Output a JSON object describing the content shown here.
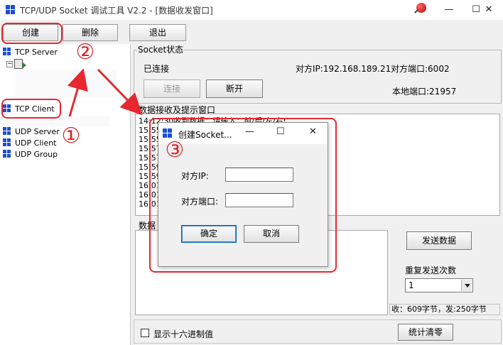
{
  "window": {
    "title": "TCP/UDP Socket 调试工具 V2.2 - [数据收发窗口]",
    "minimize_glyph": "—",
    "maximize_glyph": "☐",
    "close_glyph": "✕"
  },
  "toolbar": {
    "create_label": "创建",
    "delete_label": "删除",
    "exit_label": "退出"
  },
  "tree": {
    "tcp_server": "TCP Server",
    "tcp_client": "TCP Client",
    "udp_server": "UDP Server",
    "udp_client": "UDP Client",
    "udp_group": "UDP Group"
  },
  "socket_status": {
    "group_title": "Socket状态",
    "state": "已连接",
    "peer_ip": "对方IP:192.168.189.21",
    "peer_port": "对方端口:6002",
    "local_port": "本地端口:21957",
    "connect_label": "连接",
    "disconnect_label": "断开"
  },
  "receive": {
    "group_title": "数据接收及提示窗口",
    "lines": [
      "14:12:30收到数据：请输入：前/后/左/右!",
      "15:55",
      "15:55",
      "15:57",
      "15:57",
      "15:59",
      "15:59",
      "16:01",
      "16:01",
      "16:01"
    ]
  },
  "send": {
    "group_title": "数据",
    "send_label": "发送数据",
    "repeat_label": "重复发送次数",
    "repeat_value": "1",
    "status": "收：609字节，发:250字节"
  },
  "bottom": {
    "hex_label": "显示十六进制值",
    "clear_label": "统计清零"
  },
  "dialog": {
    "title": "创建Socket...",
    "minimize_glyph": "—",
    "maximize_glyph": "☐",
    "close_glyph": "✕",
    "ip_label": "对方IP:",
    "port_label": "对方端口:",
    "ip_value": "",
    "port_value": "",
    "ok_label": "确定",
    "cancel_label": "取消"
  },
  "annotations": {
    "one": "①",
    "two": "②",
    "three": "③",
    "color": "#e8282e"
  },
  "colors": {
    "accent_blue": "#1c4fd4",
    "annotation_red": "#e8282e"
  }
}
